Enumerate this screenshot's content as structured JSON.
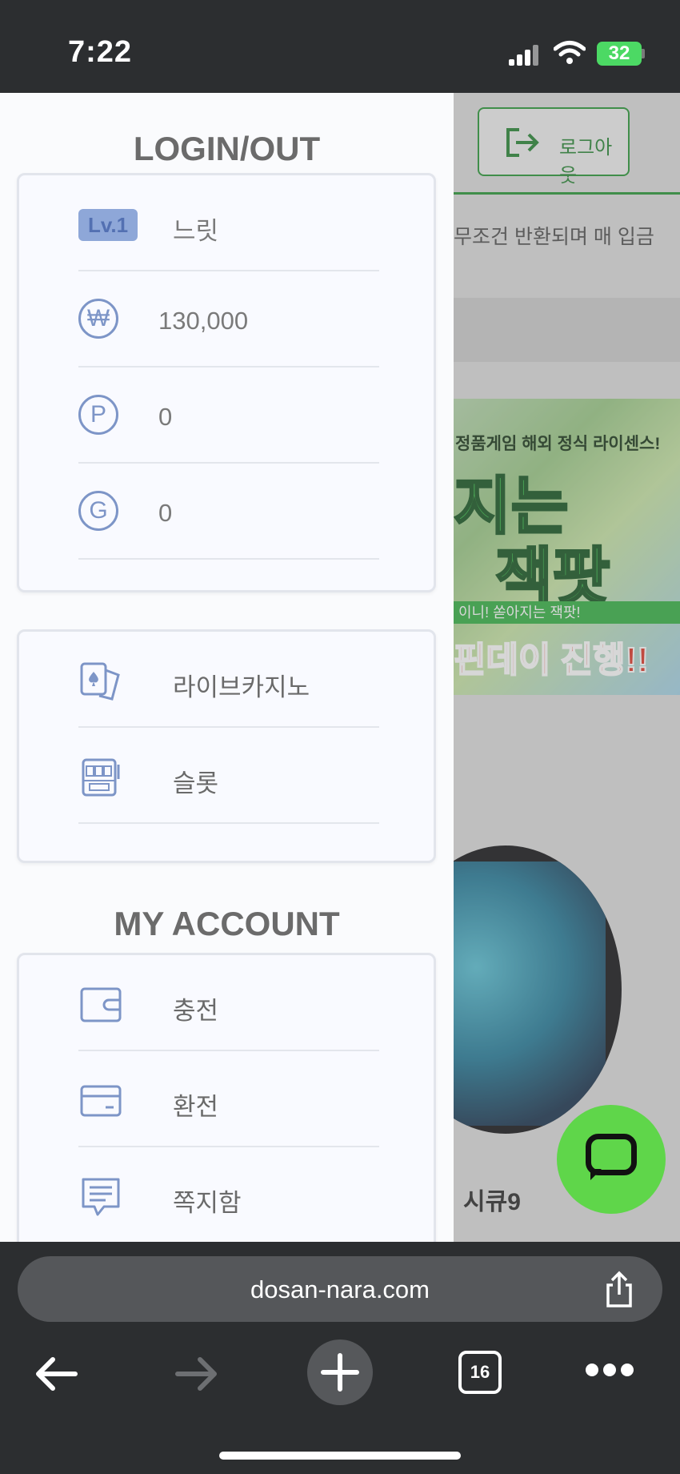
{
  "status_bar": {
    "time": "7:22",
    "battery": "32"
  },
  "background_page": {
    "logout_label": "로그아웃",
    "marquee_text": "무조건 반환되며 매 입금",
    "banner": {
      "top_line": "정품게임 해외 정식 라이센스!",
      "big_line_1": "지는",
      "big_line_2": "잭팟",
      "strip_text": "이니! 쏟아지는 잭팟!",
      "bottom_line": "핀데이 진행!!"
    },
    "game_title": "시큐9"
  },
  "drawer": {
    "login_section": {
      "title": "LOGIN/OUT",
      "level_badge": "Lv.1",
      "username": "느릿",
      "balance_icon": "₩",
      "balance": "130,000",
      "points_icon": "P",
      "points": "0",
      "gold_icon": "G",
      "gold": "0"
    },
    "games": [
      {
        "label": "라이브카지노",
        "icon": "cards-icon"
      },
      {
        "label": "슬롯",
        "icon": "slot-machine-icon"
      }
    ],
    "account_section": {
      "title": "MY ACCOUNT",
      "items": [
        {
          "label": "충전",
          "icon": "wallet-icon"
        },
        {
          "label": "환전",
          "icon": "card-icon"
        },
        {
          "label": "쪽지함",
          "icon": "message-icon"
        }
      ]
    }
  },
  "browser": {
    "url": "dosan-nara.com",
    "tab_count": "16"
  },
  "colors": {
    "accent_green": "#2f9a3c",
    "icon_blue": "#7d95c7",
    "chat_green": "#5fd64a"
  }
}
